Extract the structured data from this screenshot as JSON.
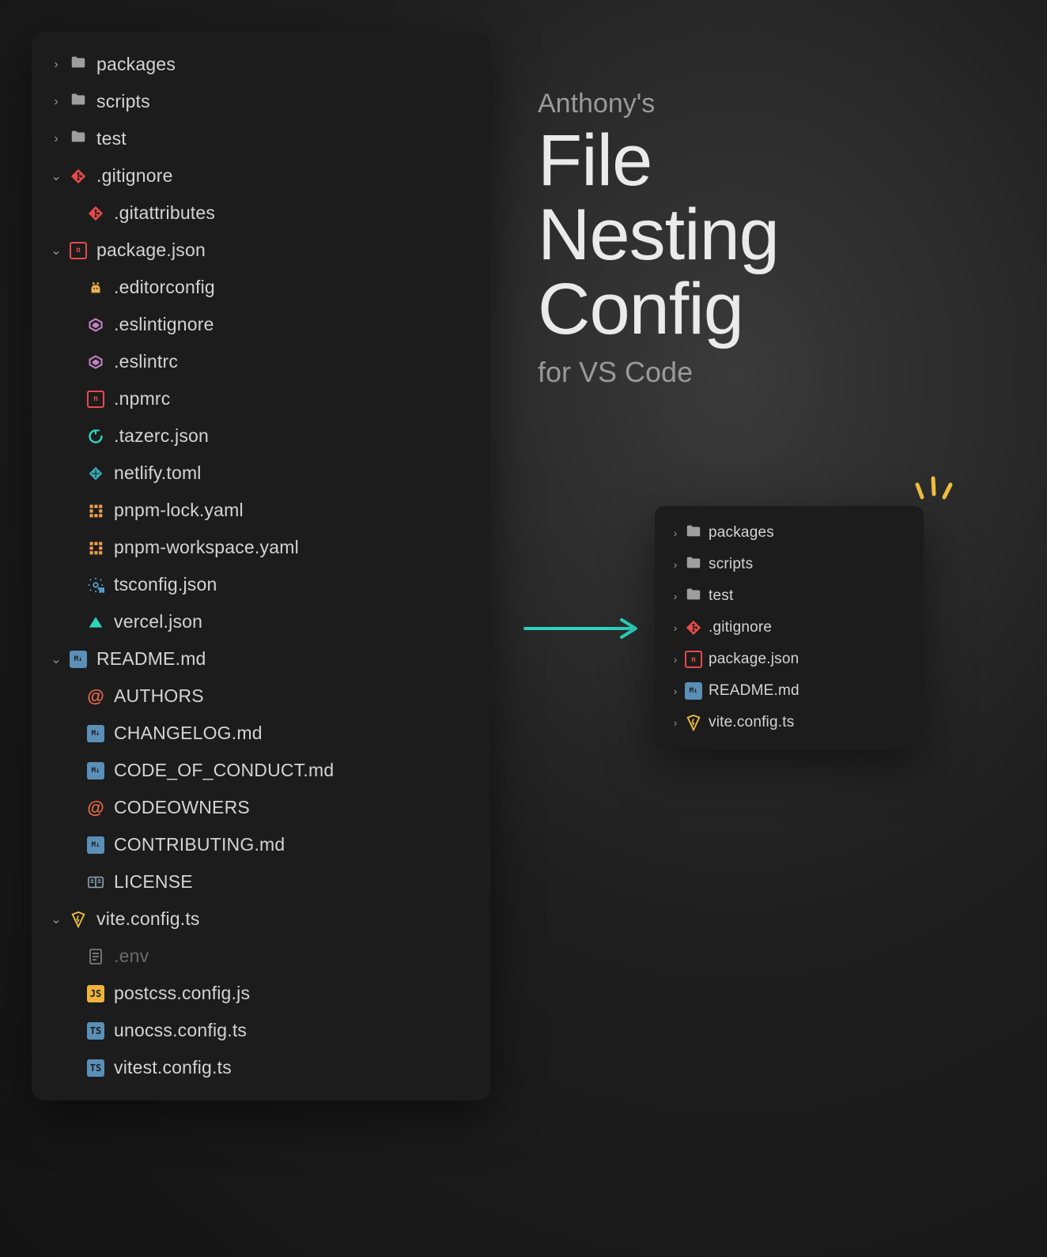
{
  "title": {
    "pre": "Anthony's",
    "line1": "File",
    "line2": "Nesting",
    "line3": "Config",
    "post": "for VS Code"
  },
  "left_tree": [
    {
      "kind": "collapsed",
      "icon": "folder",
      "label": "packages"
    },
    {
      "kind": "collapsed",
      "icon": "folder",
      "label": "scripts"
    },
    {
      "kind": "collapsed",
      "icon": "folder",
      "label": "test"
    },
    {
      "kind": "expanded",
      "icon": "git",
      "label": ".gitignore"
    },
    {
      "kind": "child",
      "icon": "git",
      "label": ".gitattributes"
    },
    {
      "kind": "expanded",
      "icon": "npm",
      "label": "package.json"
    },
    {
      "kind": "child",
      "icon": "editorconfig",
      "label": ".editorconfig"
    },
    {
      "kind": "child",
      "icon": "eslint",
      "label": ".eslintignore"
    },
    {
      "kind": "child",
      "icon": "eslint",
      "label": ".eslintrc"
    },
    {
      "kind": "child",
      "icon": "npm",
      "label": ".npmrc"
    },
    {
      "kind": "child",
      "icon": "tazerc",
      "label": ".tazerc.json"
    },
    {
      "kind": "child",
      "icon": "netlify",
      "label": "netlify.toml"
    },
    {
      "kind": "child",
      "icon": "pnpm",
      "label": "pnpm-lock.yaml"
    },
    {
      "kind": "child",
      "icon": "pnpm",
      "label": "pnpm-workspace.yaml"
    },
    {
      "kind": "child",
      "icon": "tsconfig",
      "label": "tsconfig.json"
    },
    {
      "kind": "child",
      "icon": "vercel",
      "label": "vercel.json"
    },
    {
      "kind": "expanded",
      "icon": "md",
      "label": "README.md"
    },
    {
      "kind": "child",
      "icon": "at",
      "label": "AUTHORS"
    },
    {
      "kind": "child",
      "icon": "md",
      "label": "CHANGELOG.md"
    },
    {
      "kind": "child",
      "icon": "md",
      "label": "CODE_OF_CONDUCT.md"
    },
    {
      "kind": "child",
      "icon": "at",
      "label": "CODEOWNERS"
    },
    {
      "kind": "child",
      "icon": "md",
      "label": "CONTRIBUTING.md"
    },
    {
      "kind": "child",
      "icon": "license",
      "label": "LICENSE"
    },
    {
      "kind": "expanded",
      "icon": "vite",
      "label": "vite.config.ts"
    },
    {
      "kind": "child",
      "icon": "env",
      "label": ".env",
      "dim": true
    },
    {
      "kind": "child",
      "icon": "js",
      "label": "postcss.config.js"
    },
    {
      "kind": "child",
      "icon": "ts",
      "label": "unocss.config.ts"
    },
    {
      "kind": "child",
      "icon": "ts",
      "label": "vitest.config.ts"
    }
  ],
  "right_tree": [
    {
      "kind": "collapsed",
      "icon": "folder",
      "label": "packages"
    },
    {
      "kind": "collapsed",
      "icon": "folder",
      "label": "scripts"
    },
    {
      "kind": "collapsed",
      "icon": "folder",
      "label": "test"
    },
    {
      "kind": "collapsed",
      "icon": "git",
      "label": ".gitignore"
    },
    {
      "kind": "collapsed",
      "icon": "npm",
      "label": "package.json"
    },
    {
      "kind": "collapsed",
      "icon": "md",
      "label": "README.md"
    },
    {
      "kind": "collapsed",
      "icon": "vite",
      "label": "vite.config.ts"
    }
  ],
  "icons": {
    "folder_color": "#9e9e9e",
    "git_color": "#e64a4a",
    "npm_bg": "#e64a4a",
    "md_bg": "#5a8fb8",
    "js_bg": "#f0b43c",
    "ts_bg": "#5a8fb8",
    "eslint_color": "#c084c0",
    "netlify_color": "#3fb8c6",
    "pnpm_color": "#f0a050",
    "tsconfig_color": "#5aa0d0",
    "vercel_color": "#2dd4bf",
    "at_color": "#e66a4a",
    "license_color": "#8aa0b0",
    "vite_color": "#f0c040",
    "env_color": "#888",
    "editorconfig_color": "#e8b050",
    "tazerc_color": "#2dd4bf"
  }
}
